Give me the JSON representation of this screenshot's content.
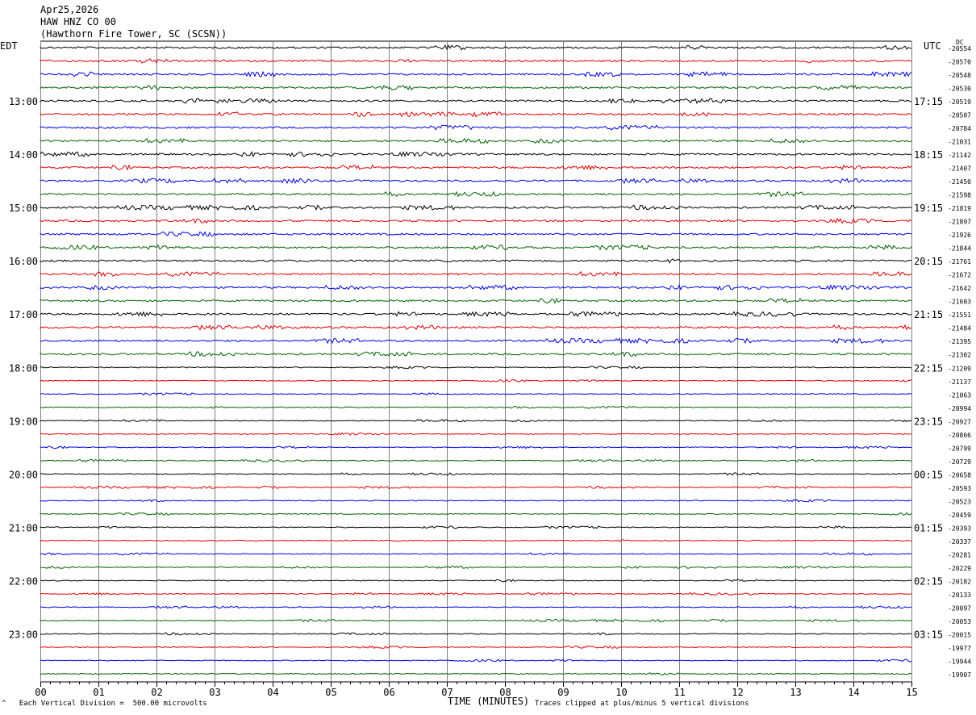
{
  "header": {
    "date": "Apr25,2026",
    "station": "HAW HNZ CO 00",
    "location": "(Hawthorn Fire Tower, SC (SCSN))"
  },
  "left_axis_label": "EDT",
  "right_axis_label": "UTC",
  "dc_label": "DC",
  "footer": {
    "scale_note": "Each Vertical Division =  500.00 microvolts",
    "clip_note": "Traces clipped at plus/minus 5 vertical divisions",
    "marker": "^"
  },
  "chart_data": {
    "type": "line",
    "xlabel": "TIME (MINUTES)",
    "x_ticks": [
      "00",
      "01",
      "02",
      "03",
      "04",
      "05",
      "06",
      "07",
      "08",
      "09",
      "10",
      "11",
      "12",
      "13",
      "14",
      "15"
    ],
    "xlim": [
      0,
      15
    ],
    "trace_colors": [
      "#000000",
      "#e00000",
      "#0000e0",
      "#006400"
    ],
    "grid_color": "#808080",
    "edt_labels": [
      {
        "row": 4,
        "label": "13:00"
      },
      {
        "row": 8,
        "label": "14:00"
      },
      {
        "row": 12,
        "label": "15:00"
      },
      {
        "row": 16,
        "label": "16:00"
      },
      {
        "row": 20,
        "label": "17:00"
      },
      {
        "row": 24,
        "label": "18:00"
      },
      {
        "row": 28,
        "label": "19:00"
      },
      {
        "row": 32,
        "label": "20:00"
      },
      {
        "row": 36,
        "label": "21:00"
      },
      {
        "row": 40,
        "label": "22:00"
      },
      {
        "row": 44,
        "label": "23:00"
      }
    ],
    "utc_labels": [
      {
        "row": 4,
        "label": "17:15"
      },
      {
        "row": 8,
        "label": "18:15"
      },
      {
        "row": 12,
        "label": "19:15"
      },
      {
        "row": 16,
        "label": "20:15"
      },
      {
        "row": 20,
        "label": "21:15"
      },
      {
        "row": 24,
        "label": "22:15"
      },
      {
        "row": 28,
        "label": "23:15"
      },
      {
        "row": 32,
        "label": "00:15"
      },
      {
        "row": 36,
        "label": "01:15"
      },
      {
        "row": 40,
        "label": "02:15"
      },
      {
        "row": 44,
        "label": "03:15"
      }
    ],
    "dc_values": [
      "-20554",
      "-20570",
      "-20548",
      "-20530",
      "-20519",
      "-20507",
      "-20784",
      "-21031",
      "-21142",
      "-21407",
      "-21450",
      "-21598",
      "-21819",
      "-21897",
      "-21926",
      "-21844",
      "-21761",
      "-21672",
      "-21642",
      "-21603",
      "-21551",
      "-21484",
      "-21395",
      "-21302",
      "-21209",
      "-21137",
      "-21063",
      "-20994",
      "-20927",
      "-20866",
      "-20799",
      "-20729",
      "-20658",
      "-20593",
      "-20523",
      "-20459",
      "-20393",
      "-20337",
      "-20281",
      "-20229",
      "-20182",
      "-20133",
      "-20097",
      "-20053",
      "-20015",
      "-19977",
      "-19944",
      "-19907"
    ]
  }
}
